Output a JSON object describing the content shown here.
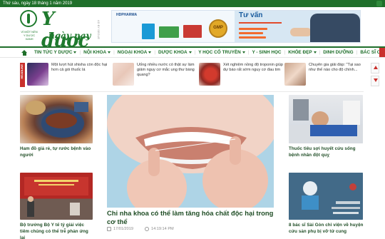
{
  "topbar": {
    "date": "Thứ sáu, ngày 18 tháng 1 năm 2019"
  },
  "logo": {
    "title": "Y dược",
    "subtitle": "ngày nay",
    "tagline": "VÌ MỘT NỀN Y DƯỢC XANH"
  },
  "ad": {
    "label": "AD BY SEGUE",
    "brand": "HDPHARMA",
    "gmp": "GMP",
    "tuvan": "Tư vấn"
  },
  "nav": {
    "items": [
      {
        "label": "TIN TỨC Y DƯỢC",
        "dropdown": true
      },
      {
        "label": "NỘI KHOA",
        "dropdown": true
      },
      {
        "label": "NGOẠI KHOA",
        "dropdown": true
      },
      {
        "label": "DƯỢC KHOA",
        "dropdown": true
      },
      {
        "label": "Y HỌC CỔ TRUYỀN",
        "dropdown": true
      },
      {
        "label": "Y - SINH HỌC",
        "dropdown": false
      },
      {
        "label": "KHỎE ĐẸP",
        "dropdown": true
      },
      {
        "label": "DINH DƯỠNG",
        "dropdown": false
      },
      {
        "label": "BÁC SĨ CỦA BẠN",
        "dropdown": false
      }
    ]
  },
  "headlines": {
    "label": "HEADLINE",
    "items": [
      {
        "text": "Một lượt hút shisha còn độc hại hơn cả gói thuốc lá"
      },
      {
        "text": "Uống nhiều nước có thật sự làm giảm nguy cơ mắc ung thư bàng quang?"
      },
      {
        "text": "Xét nghiệm nồng độ troponin giúp dự báo rất sớm nguy cơ đau tim"
      },
      {
        "text": "Chuyên gia giải đáp: \"Tại sao như thế nào cho độ chính..."
      }
    ]
  },
  "left_articles": [
    {
      "caption": "Ham đồ giả rẻ, tự rước bệnh vào người"
    },
    {
      "caption": "Bộ trưởng Bộ Y tế tỷ giải việc tiêm chủng có thể trễ phản ứng lại"
    }
  ],
  "feature": {
    "title": "Chỉ nha khoa có thể làm tăng hóa chất độc hại trong cơ thể",
    "date": "17/01/2019",
    "time": "14:19:14 PM"
  },
  "right_articles": [
    {
      "caption": "Thuốc tiêu sợi huyết cứu sống bệnh nhân đột quỵ"
    },
    {
      "caption": "8 bác sĩ Sài Gòn chỉ viện về huyện cứu sản phụ bị vỡ tử cung"
    }
  ]
}
